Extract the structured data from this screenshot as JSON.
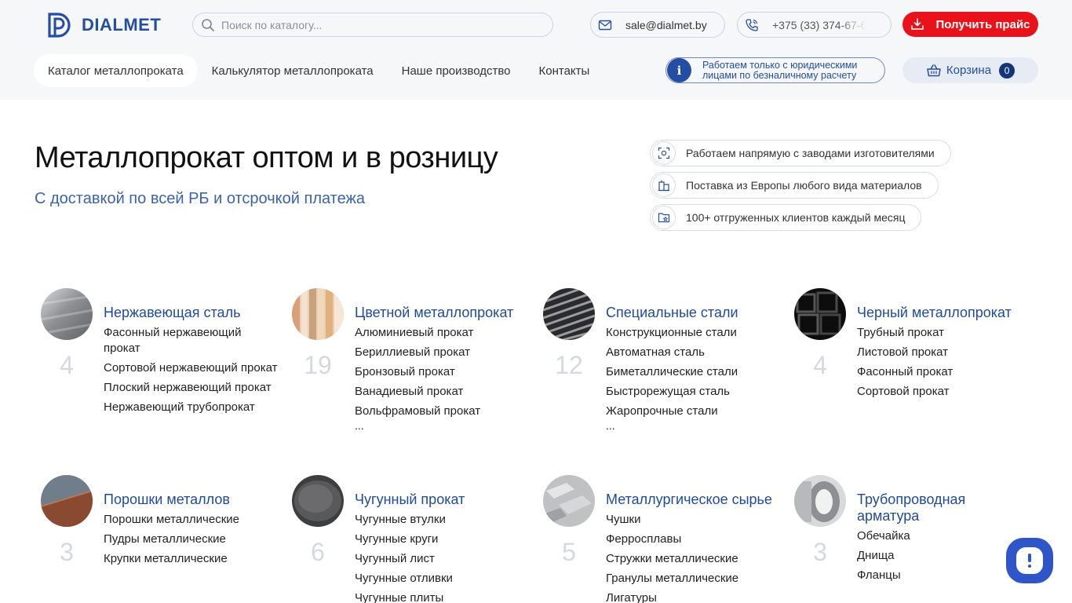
{
  "brand": {
    "name": "DIALMET"
  },
  "header": {
    "search_placeholder": "Поиск по каталогу...",
    "email": "sale@dialmet.by",
    "phone": "+375 (33) 374-67-6",
    "price_button": "Получить прайс",
    "nav": [
      {
        "label": "Каталог металлопроката",
        "active": true
      },
      {
        "label": "Калькулятор металлопроката",
        "active": false
      },
      {
        "label": "Наше производство",
        "active": false
      },
      {
        "label": "Контакты",
        "active": false
      }
    ],
    "notice_line1": "Работаем только с юридическими",
    "notice_line2": "лицами по безналичному расчету",
    "cart_label": "Корзина",
    "cart_count": "0"
  },
  "hero": {
    "title": "Металлопрокат оптом и в розницу",
    "subtitle": "С доставкой по всей РБ и отсрочкой платежа",
    "features": [
      "Работаем напрямую с заводами изготовителями",
      "Поставка из Европы любого вида материалов",
      "100+ отгруженных клиентов каждый месяц"
    ]
  },
  "catalog": [
    {
      "title": "Нержавеющая сталь",
      "count": "4",
      "items": [
        "Фасонный нержавеющий прокат",
        "Сортовой нержавеющий прокат",
        "Плоский нержавеющий прокат",
        "Нержавеющий трубопрокат"
      ],
      "more": ""
    },
    {
      "title": "Цветной металлопрокат",
      "count": "19",
      "items": [
        "Алюминиевый прокат",
        "Бериллиевый прокат",
        "Бронзовый прокат",
        "Ванадиевый прокат",
        "Вольфрамовый прокат"
      ],
      "more": "..."
    },
    {
      "title": "Специальные стали",
      "count": "12",
      "items": [
        "Конструкционные стали",
        "Автоматная сталь",
        "Биметаллические стали",
        "Быстрорежущая сталь",
        "Жаропрочные стали"
      ],
      "more": "..."
    },
    {
      "title": "Черный металлопрокат",
      "count": "4",
      "items": [
        "Трубный прокат",
        "Листовой прокат",
        "Фасонный прокат",
        "Сортовой прокат"
      ],
      "more": ""
    },
    {
      "title": "Порошки металлов",
      "count": "3",
      "items": [
        "Порошки металлические",
        "Пудры металлические",
        "Крупки металлические"
      ],
      "more": ""
    },
    {
      "title": "Чугунный прокат",
      "count": "6",
      "items": [
        "Чугунные втулки",
        "Чугунные круги",
        "Чугунный лист",
        "Чугунные отливки",
        "Чугунные плиты"
      ],
      "more": ""
    },
    {
      "title": "Металлургическое сырье",
      "count": "5",
      "items": [
        "Чушки",
        "Ферросплавы",
        "Стружки металлические",
        "Гранулы металлические",
        "Лигатуры"
      ],
      "more": ""
    },
    {
      "title": "Трубопроводная арматура",
      "count": "3",
      "items": [
        "Обечайка",
        "Днища",
        "Фланцы"
      ],
      "more": ""
    }
  ]
}
